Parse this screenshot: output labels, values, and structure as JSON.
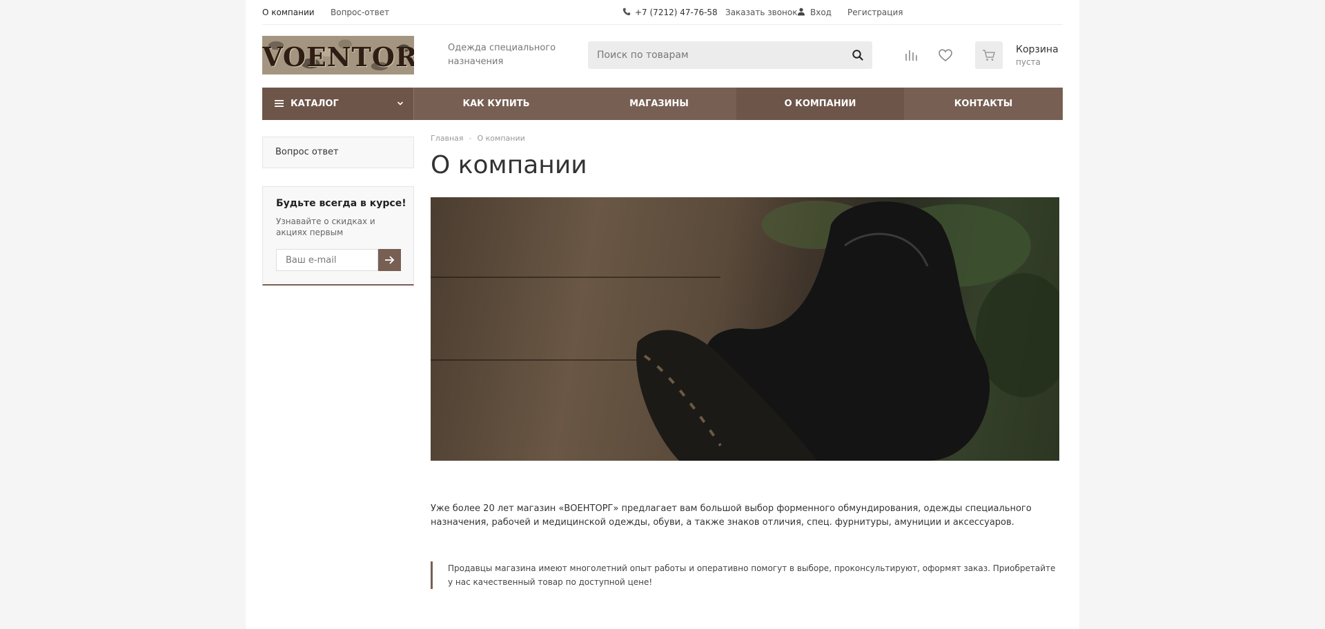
{
  "topbar": {
    "links": [
      "О компании",
      "Вопрос-ответ"
    ],
    "phone": "+7 (7212) 47-76-58",
    "callback": "Заказать звонок",
    "login": "Вход",
    "register": "Регистрация"
  },
  "header": {
    "logo_text": "VOENTORG",
    "slogan": "Одежда специального назначения",
    "search_placeholder": "Поиск по товарам",
    "cart_title": "Корзина",
    "cart_status": "пуста"
  },
  "nav": {
    "catalog": "КАТАЛОГ",
    "items": [
      "КАК КУПИТЬ",
      "МАГАЗИНЫ",
      "О КОМПАНИИ",
      "КОНТАКТЫ"
    ],
    "active_index": 2
  },
  "sidebar": {
    "menu_item": "Вопрос ответ",
    "subscribe_title": "Будьте всегда в курсе!",
    "subscribe_text": "Узнавайте о скидках и акциях первым",
    "email_placeholder": "Ваш e-mail"
  },
  "breadcrumbs": [
    "Главная",
    "О компании"
  ],
  "content": {
    "title": "О компании",
    "intro": "Уже более 20 лет магазин «ВОЕНТОРГ» предлагает вам большой выбор форменного обмундирования, одежды специального назначения, рабочей и медицинской одежды, обуви, а также знаков отличия, спец. фурнитуры, амуниции и аксессуаров.",
    "quote": "Продавцы магазина имеют многолетний опыт работы и оперативно помогут в выборе, проконсультируют, оформят заказ. Приобретайте у нас качественный товар по доступной цене!"
  },
  "colors": {
    "brand": "#775f53",
    "brand_dark": "#6d5549"
  }
}
